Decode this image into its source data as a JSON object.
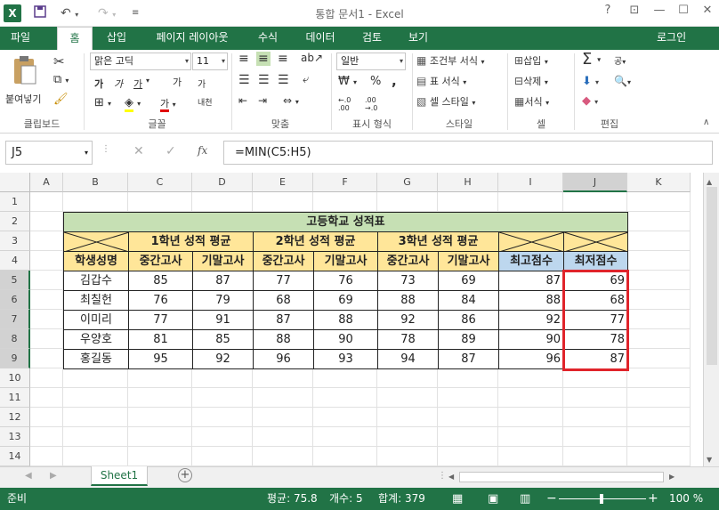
{
  "app": {
    "logo": "X",
    "title": "통합 문서1 - Excel",
    "help": "?"
  },
  "tabs": [
    {
      "label": "파일"
    },
    {
      "label": "홈"
    },
    {
      "label": "삽입"
    },
    {
      "label": "페이지 레이아웃"
    },
    {
      "label": "수식"
    },
    {
      "label": "데이터"
    },
    {
      "label": "검토"
    },
    {
      "label": "보기"
    }
  ],
  "user": {
    "login": "로그인"
  },
  "ribbon": {
    "clipboard": {
      "label": "클립보드",
      "paste": "붙여넣기"
    },
    "font": {
      "label": "글꼴",
      "name": "맑은 고딕",
      "size": "11",
      "bold": "가",
      "italic": "가",
      "underline": "가",
      "grow": "가",
      "shrink": "가",
      "color_a": "가",
      "phonetic": "내천"
    },
    "align": {
      "label": "맞춤"
    },
    "number": {
      "label": "표시 형식",
      "format": "일반",
      "percent": "%",
      "comma": ",",
      "inc": "←.0\n.00",
      "dec": ".00\n→.0"
    },
    "styles": {
      "label": "스타일",
      "cond": "조건부 서식",
      "table": "표 서식",
      "cell": "셀 스타일"
    },
    "cells": {
      "label": "셀",
      "insert": "삽입",
      "delete": "삭제",
      "format": "서식"
    },
    "edit": {
      "label": "편집",
      "sum": "Σ",
      "sort": "공",
      "find": "🔍"
    }
  },
  "formula": {
    "namebox": "J5",
    "fx": "fx",
    "value": "=MIN(C5:H5)"
  },
  "columns": [
    "A",
    "B",
    "C",
    "D",
    "E",
    "F",
    "G",
    "H",
    "I",
    "J",
    "K"
  ],
  "rows": [
    "1",
    "2",
    "3",
    "4",
    "5",
    "6",
    "7",
    "8",
    "9",
    "10",
    "11",
    "12",
    "13",
    "14"
  ],
  "table": {
    "title": "고등학교 성적표",
    "year1": "1학년 성적 평균",
    "year2": "2학년 성적 평균",
    "year3": "3학년 성적 평균",
    "headers": [
      "학생성명",
      "중간고사",
      "기말고사",
      "중간고사",
      "기말고사",
      "중간고사",
      "기말고사",
      "최고점수",
      "최저점수"
    ],
    "students": [
      {
        "name": "김갑수",
        "scores": [
          "85",
          "87",
          "77",
          "76",
          "73",
          "69"
        ],
        "max": "87",
        "min": "69"
      },
      {
        "name": "최칠헌",
        "scores": [
          "76",
          "79",
          "68",
          "69",
          "88",
          "84"
        ],
        "max": "88",
        "min": "68"
      },
      {
        "name": "이미리",
        "scores": [
          "77",
          "91",
          "87",
          "88",
          "92",
          "86"
        ],
        "max": "92",
        "min": "77"
      },
      {
        "name": "우양호",
        "scores": [
          "81",
          "85",
          "88",
          "90",
          "78",
          "89"
        ],
        "max": "90",
        "min": "78"
      },
      {
        "name": "홍길동",
        "scores": [
          "95",
          "92",
          "96",
          "93",
          "94",
          "87"
        ],
        "max": "96",
        "min": "87"
      }
    ]
  },
  "sheet": {
    "name": "Sheet1",
    "add": "+"
  },
  "status": {
    "ready": "준비",
    "avg": "평균: 75.8",
    "count": "개수: 5",
    "sum": "합계: 379",
    "zoom": "100 %",
    "minus": "−",
    "plus": "+"
  },
  "colors": {
    "excel_green": "#217346",
    "title_fill": "#c6e0b4",
    "header_fill": "#ffe699",
    "blue_fill": "#bdd7ee",
    "select_red": "#e0242b"
  }
}
